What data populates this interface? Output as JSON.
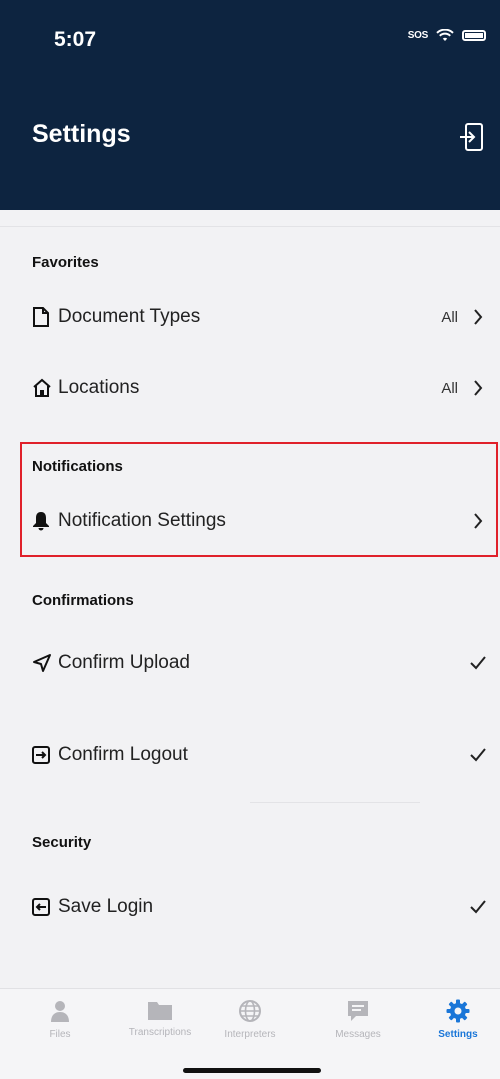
{
  "status_bar": {
    "time": "5:07",
    "sos": "SOS"
  },
  "header": {
    "title": "Settings"
  },
  "sections": {
    "favorites": {
      "title": "Favorites",
      "items": [
        {
          "label": "Document Types",
          "value": "All"
        },
        {
          "label": "Locations",
          "value": "All"
        }
      ]
    },
    "notifications": {
      "title": "Notifications",
      "items": [
        {
          "label": "Notification Settings"
        }
      ]
    },
    "confirmations": {
      "title": "Confirmations",
      "items": [
        {
          "label": "Confirm Upload",
          "checked": true
        },
        {
          "label": "Confirm Logout",
          "checked": true
        }
      ]
    },
    "security": {
      "title": "Security",
      "items": [
        {
          "label": "Save Login",
          "checked": true
        }
      ]
    }
  },
  "tabbar": {
    "tabs": [
      {
        "label": "Files",
        "icon": "person-icon",
        "active": false
      },
      {
        "label": "Transcriptions",
        "icon": "folder-icon",
        "active": false
      },
      {
        "label": "Interpreters",
        "icon": "globe-icon",
        "active": false
      },
      {
        "label": "Messages",
        "icon": "message-icon",
        "active": false
      },
      {
        "label": "Settings",
        "icon": "gear-icon",
        "active": true
      }
    ]
  },
  "colors": {
    "header_bg": "#0d2440",
    "active_tab": "#1a76d8",
    "highlight_border": "#e0202a"
  }
}
